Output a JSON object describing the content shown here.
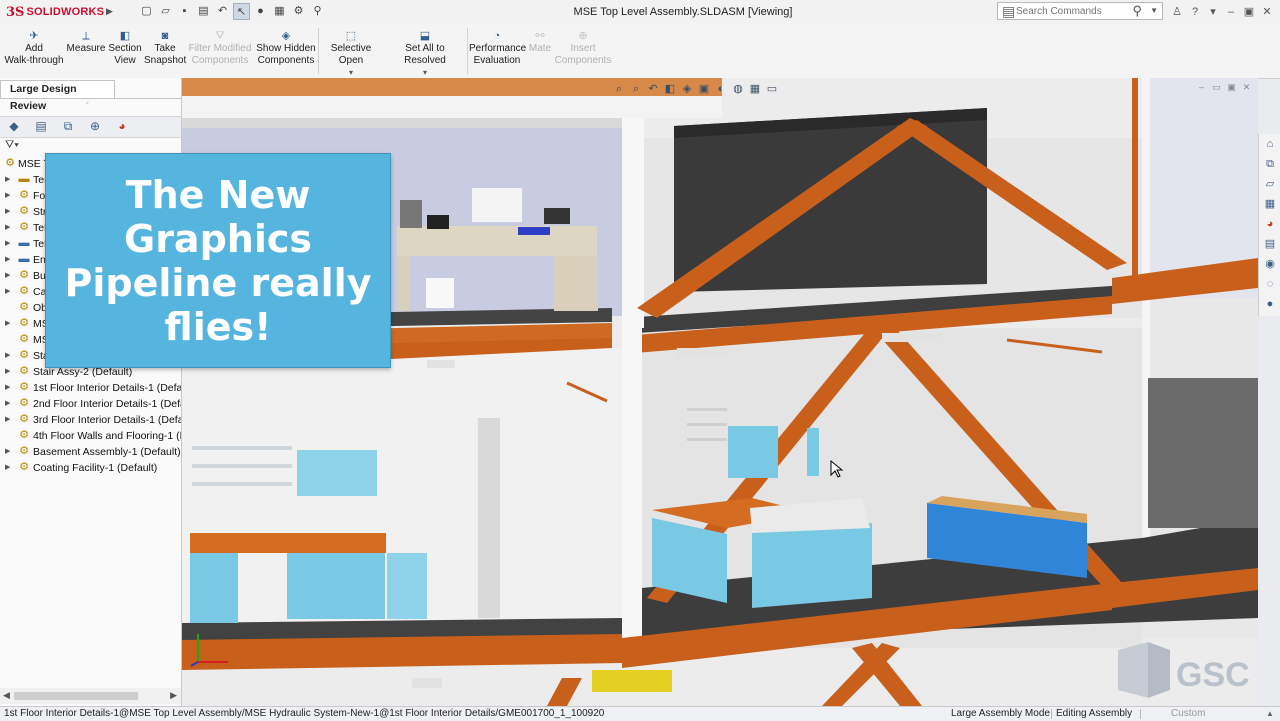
{
  "titlebar": {
    "logo_prefix": "3S",
    "logo_word": "SOLIDWORKS",
    "document_title": "MSE Top Level Assembly.SLDASM [Viewing]",
    "search_placeholder": "Search Commands",
    "icons": [
      "new-icon",
      "open-icon",
      "save-icon",
      "print-icon",
      "undo-icon",
      "select-icon",
      "rebuild-icon",
      "file-properties-icon",
      "options-icon",
      "pin-icon"
    ]
  },
  "commands": [
    {
      "line1": "Add",
      "line2": "Walk-through",
      "enabled": true
    },
    {
      "line1": "Measure",
      "line2": "",
      "enabled": true
    },
    {
      "line1": "Section",
      "line2": "View",
      "enabled": true
    },
    {
      "line1": "Take",
      "line2": "Snapshot",
      "enabled": true
    },
    {
      "line1": "Filter Modified",
      "line2": "Components",
      "enabled": false
    },
    {
      "line1": "Show Hidden",
      "line2": "Components",
      "enabled": true
    },
    {
      "line1": "Selective Open",
      "line2": "",
      "enabled": true
    },
    {
      "line1": "Set All to Resolved",
      "line2": "",
      "enabled": true
    },
    {
      "line1": "Performance",
      "line2": "Evaluation",
      "enabled": true
    },
    {
      "line1": "Mate",
      "line2": "",
      "enabled": false
    },
    {
      "line1": "Insert",
      "line2": "Components",
      "enabled": false
    }
  ],
  "left_pane": {
    "tab_label": "Large Design Review",
    "tree": [
      {
        "label": "MSE T",
        "root": true,
        "icon": "assembly-icon"
      },
      {
        "label": "Ter",
        "icon": "folder-icon"
      },
      {
        "label": "Fo",
        "icon": "part-icon"
      },
      {
        "label": "Str",
        "icon": "part-icon"
      },
      {
        "label": "Tel",
        "icon": "part-icon"
      },
      {
        "label": "Tel",
        "icon": "folder-icon"
      },
      {
        "label": "Ene",
        "icon": "folder-icon"
      },
      {
        "label": "Bu",
        "icon": "part-icon"
      },
      {
        "label": "Cat",
        "icon": "part-icon"
      },
      {
        "label": "Ob",
        "icon": "part-icon"
      },
      {
        "label": "MS",
        "icon": "part-icon"
      },
      {
        "label": "MS",
        "icon": "part-icon"
      },
      {
        "label": "Sta",
        "icon": "part-icon"
      },
      {
        "label": "Stair Assy-2 (Default)",
        "icon": "part-icon"
      },
      {
        "label": "1st Floor Interior Details-1 (Defau",
        "icon": "part-icon"
      },
      {
        "label": "2nd Floor Interior Details-1 (Defa",
        "icon": "part-icon"
      },
      {
        "label": "3rd Floor Interior Details-1 (Defa",
        "icon": "part-icon"
      },
      {
        "label": "4th Floor Walls and Flooring-1 (D",
        "icon": "part-icon"
      },
      {
        "label": "Basement Assembly-1 (Default)",
        "icon": "part-icon"
      },
      {
        "label": "Coating Facility-1 (Default)",
        "icon": "part-icon"
      }
    ]
  },
  "callout": {
    "text": "The New Graphics Pipeline really flies!",
    "background": "#55b5df"
  },
  "watermark": {
    "text": "GSC"
  },
  "statusbar": {
    "path": "1st Floor Interior Details-1@MSE Top Level Assembly/MSE Hydraulic System-New-1@1st Floor Interior Details/GME001700_1_100920...",
    "mode": "Large Assembly Mode",
    "editing": "Editing Assembly",
    "units": "Custom"
  },
  "colors": {
    "steel_beam": "#c8601c",
    "floor_slab": "#3f3f3f",
    "cabinet": "#79c8e4",
    "toolbox": "#2f86d8"
  }
}
